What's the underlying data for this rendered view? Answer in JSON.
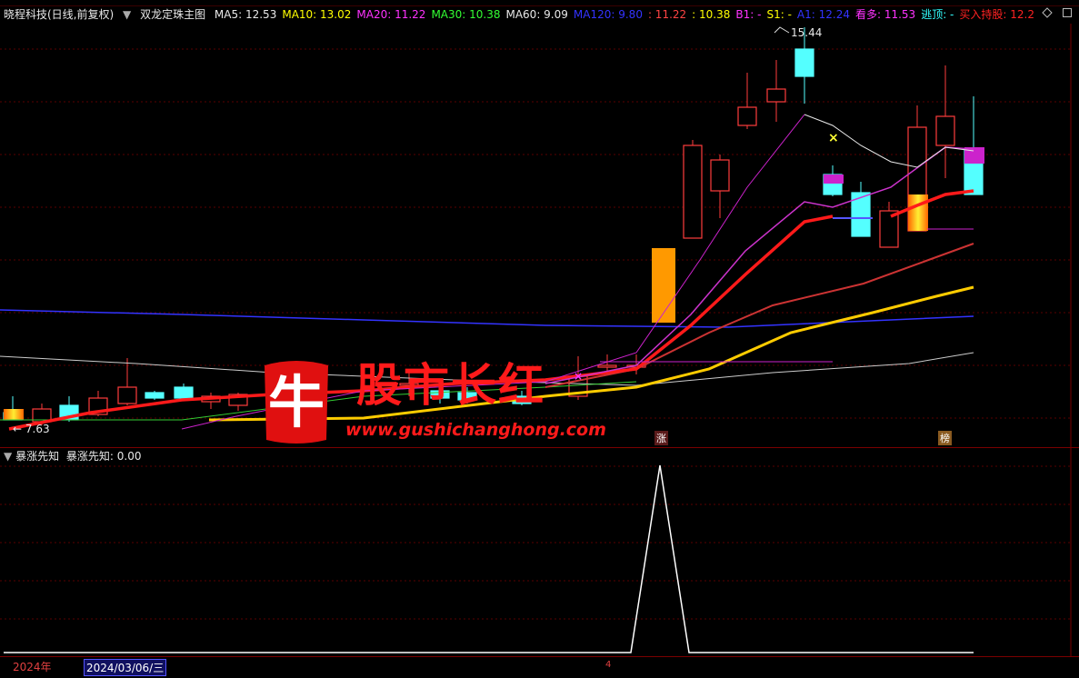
{
  "header": {
    "stock_name": "晓程科技(日线,前复权)",
    "indicator_name": "双龙定珠主图",
    "items": [
      {
        "label": "MA5: 12.53",
        "color": "#e8e8e8"
      },
      {
        "label": "MA10: 13.02",
        "color": "#ffff00"
      },
      {
        "label": "MA20: 11.22",
        "color": "#ff33ff"
      },
      {
        "label": "MA30: 10.38",
        "color": "#33ff33"
      },
      {
        "label": "MA60: 9.09",
        "color": "#e8e8e8"
      },
      {
        "label": "MA120: 9.80",
        "color": "#3333ff"
      },
      {
        "label": ": 11.22",
        "color": "#ff4444"
      },
      {
        "label": ": 10.38",
        "color": "#ffff00"
      },
      {
        "label": "B1: -",
        "color": "#ff33ff"
      },
      {
        "label": "S1: -",
        "color": "#ffff00"
      },
      {
        "label": "A1: 12.24",
        "color": "#3333ff"
      },
      {
        "label": "看多: 11.53",
        "color": "#ff33ff"
      },
      {
        "label": "逃顶: -",
        "color": "#33ffff"
      },
      {
        "label": "买入持股: 12.2",
        "color": "#ff2222"
      }
    ]
  },
  "price_panel": {
    "high_label": "15.44",
    "low_label": "7.63",
    "tag_zhang": "涨",
    "tag_bang": "榜"
  },
  "indicator_panel": {
    "name": "暴涨先知",
    "value_label": "暴涨先知: 0.00"
  },
  "footer": {
    "year": "2024年",
    "date": "2024/03/06/三",
    "mark": "4"
  },
  "watermark": {
    "logo_char": "牛",
    "title": "股市长红",
    "url": "www.gushichanghong.com"
  },
  "colors": {
    "up": "#ff3c3c",
    "down": "#54ffff",
    "grid": "#5a0000",
    "accent": "#ff1a1a"
  }
}
